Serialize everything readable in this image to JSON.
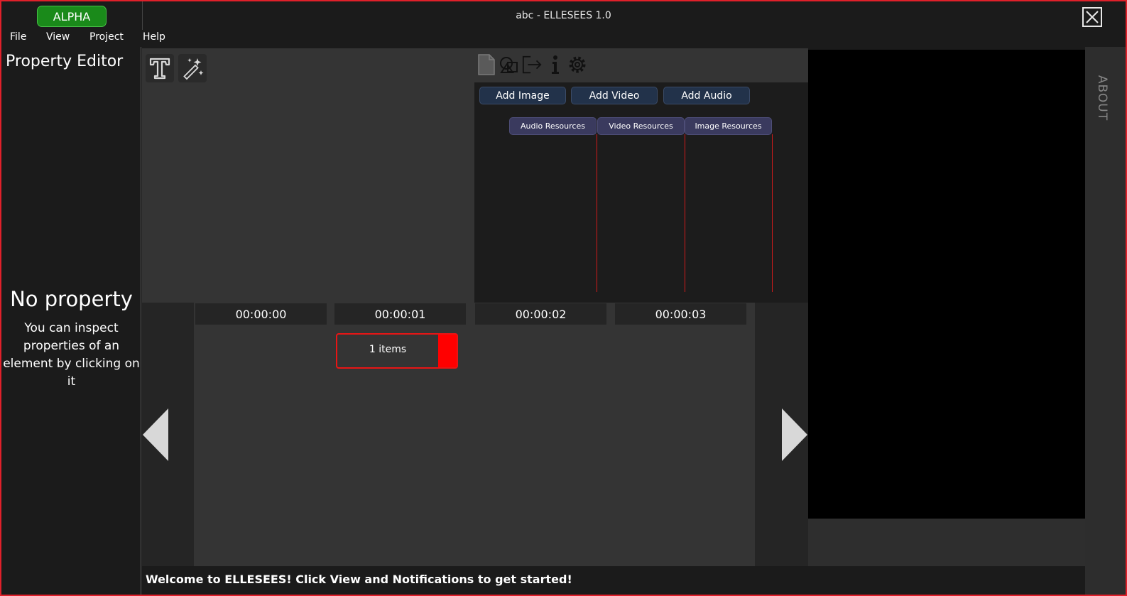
{
  "titlebar": {
    "badge": "ALPHA",
    "title": "abc - ELLESEES 1.0"
  },
  "menu": {
    "items": [
      "File",
      "View",
      "Project",
      "Help"
    ]
  },
  "property_editor": {
    "title": "Property Editor",
    "empty_title": "No property",
    "empty_description": "You can inspect properties of an element by clicking on it"
  },
  "toolbox": {
    "tools": [
      {
        "icon": "text-tool-icon"
      },
      {
        "icon": "magic-wand-icon"
      }
    ]
  },
  "resources": {
    "toolbar_icons": [
      "document-icon",
      "shapes-icon",
      "export-icon",
      "info-icon",
      "settings-gear-icon"
    ],
    "add_buttons": [
      "Add Image",
      "Add Video",
      "Add Audio"
    ],
    "tabs": [
      "Audio Resources",
      "Video Resources",
      "Image Resources"
    ],
    "accent_color": "#d01a1a"
  },
  "about": {
    "label": "ABOUT"
  },
  "timeline": {
    "timestamps": [
      "00:00:00",
      "00:00:01",
      "00:00:02",
      "00:00:03"
    ],
    "clip": {
      "label": "1 items",
      "color": "#ff0000"
    }
  },
  "status": {
    "message": "Welcome to ELLESEES! Click View and Notifications to get started!"
  }
}
